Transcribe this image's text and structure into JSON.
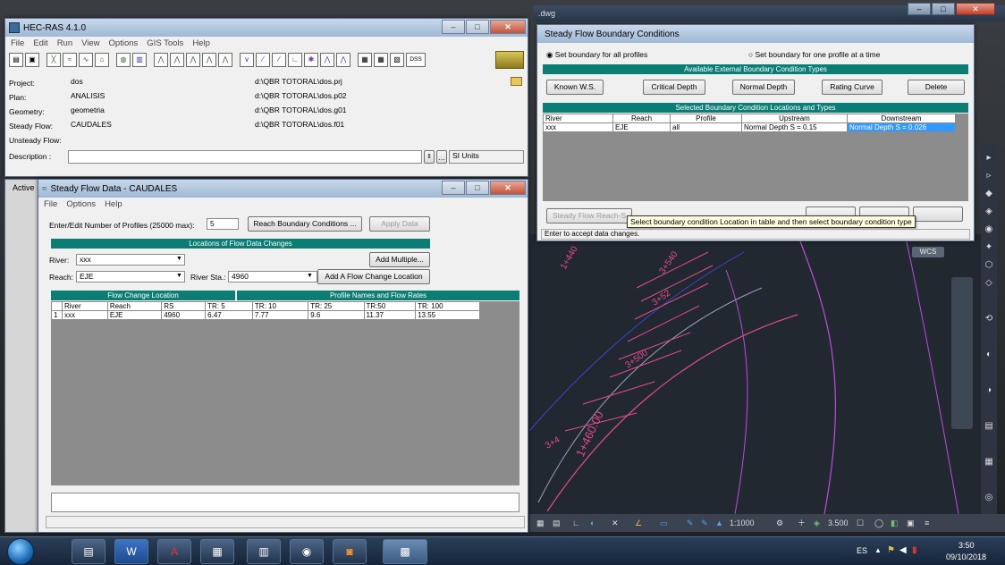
{
  "hecras": {
    "title": "HEC-RAS 4.1.0",
    "menu": [
      "File",
      "Edit",
      "Run",
      "View",
      "Options",
      "GIS Tools",
      "Help"
    ],
    "dss_label": "DSS",
    "rows": [
      {
        "label": "Project:",
        "name": "dos",
        "file": "d:\\QBR TOTORAL\\dos.prj"
      },
      {
        "label": "Plan:",
        "name": "ANALISIS",
        "file": "d:\\QBR TOTORAL\\dos.p02"
      },
      {
        "label": "Geometry:",
        "name": "geometria",
        "file": "d:\\QBR TOTORAL\\dos.g01"
      },
      {
        "label": "Steady Flow:",
        "name": "CAUDALES",
        "file": "d:\\QBR TOTORAL\\dos.f01"
      },
      {
        "label": "Unsteady Flow:",
        "name": "",
        "file": ""
      }
    ],
    "description_label": "Description :",
    "si_units": "SI Units",
    "active_label": "Active"
  },
  "steady": {
    "title": "Steady Flow Data - CAUDALES",
    "menu": [
      "File",
      "Options",
      "Help"
    ],
    "profiles_label": "Enter/Edit Number of Profiles (25000 max):",
    "profiles_value": "5",
    "reach_bc_button": "Reach Boundary Conditions ...",
    "apply_button": "Apply Data",
    "locations_header": "Locations of Flow Data Changes",
    "river_label": "River:",
    "river_value": "xxx",
    "add_multiple": "Add Multiple...",
    "reach_label": "Reach:",
    "reach_value": "EJE",
    "rs_label": "River Sta.:",
    "rs_value": "4960",
    "add_flow_change": "Add A Flow Change Location",
    "flow_change_header": "Flow Change Location",
    "profile_header": "Profile Names and Flow Rates",
    "columns": [
      "River",
      "Reach",
      "RS",
      "TR: 5",
      "TR: 10",
      "TR: 25",
      "TR:50",
      "TR: 100"
    ],
    "rows": [
      {
        "num": "1",
        "cells": [
          "xxx",
          "EJE",
          "4960",
          "6.47",
          "7.77",
          "9.6",
          "11.37",
          "13.55"
        ]
      }
    ]
  },
  "boundary": {
    "title": "Steady Flow Boundary Conditions",
    "radio_all": "Set boundary for all profiles",
    "radio_one": "Set boundary for one profile at a time",
    "available_header": "Available External Boundary Condition Types",
    "buttons": [
      "Known W.S.",
      "Critical Depth",
      "Normal Depth",
      "Rating Curve",
      "Delete"
    ],
    "selected_header": "Selected Boundary Condition Locations and Types",
    "columns": [
      "River",
      "Reach",
      "Profile",
      "Upstream",
      "Downstream"
    ],
    "rows": [
      {
        "cells": [
          "xxx",
          "EJE",
          "all",
          "Normal Depth S = 0.15",
          "Normal Depth S = 0.026"
        ]
      }
    ],
    "bottom_button": "Steady Flow Reach-S",
    "tooltip": "Select boundary condition Location in table and then select boundary condition type",
    "status": "Enter to accept data changes."
  },
  "cad": {
    "title_fragment": ".dwg",
    "wcs": "WCS",
    "scale": "1:1000",
    "value": "3.500",
    "stations": [
      "1+440",
      "1+460.00",
      "3+540",
      "3+52",
      "3+500",
      "3+4"
    ]
  },
  "taskbar": {
    "language": "ES",
    "time": "3:50",
    "date": "09/10/2018",
    "apps": [
      "start-orb",
      "explorer",
      "word",
      "autocad",
      "photos",
      "calculator",
      "chrome",
      "media",
      "hecras"
    ]
  }
}
